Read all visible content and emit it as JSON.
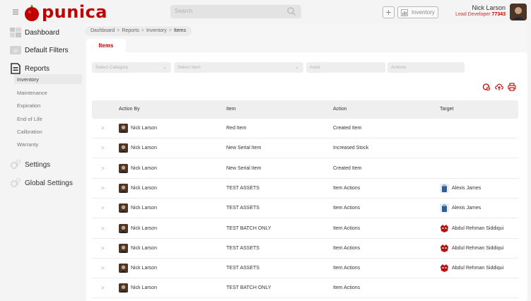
{
  "header": {
    "logo_text": "punica",
    "search_placeholder": "Search",
    "add_label": "+",
    "inventory_label": "Inventory",
    "user_name": "Nick Larson",
    "user_role": "Lead Developer",
    "user_id": "77343"
  },
  "sidebar": {
    "dashboard": "Dashboard",
    "default_filters": "Default Filters",
    "reports": "Reports",
    "report_items": [
      "Inventory",
      "Maintenance",
      "Expiration",
      "End of Life",
      "Calibration",
      "Warranty"
    ],
    "settings": "Settings",
    "global_settings": "Global Settings"
  },
  "breadcrumb": [
    "Dashboard",
    "Reports",
    "Inventory",
    "Items"
  ],
  "tab": "Items",
  "filters": {
    "category_placeholder": "Select Category",
    "item_placeholder": "Select Item",
    "actor_placeholder": "Actor",
    "actions_placeholder": "Actions"
  },
  "table": {
    "headers": [
      "Action By",
      "Item",
      "Action",
      "Target"
    ],
    "rows": [
      {
        "actor": "Nick Larson",
        "item": "Red Item",
        "action": "Created Item",
        "target": ""
      },
      {
        "actor": "Nick Larson",
        "item": "New Serial Item",
        "action": "Increased Stock",
        "target": ""
      },
      {
        "actor": "Nick Larson",
        "item": "New Serial Item",
        "action": "Created Item",
        "target": ""
      },
      {
        "actor": "Nick Larson",
        "item": "TEST ASSETS",
        "action": "Item Actions",
        "target": "Alexis James"
      },
      {
        "actor": "Nick Larson",
        "item": "TEST ASSETS",
        "action": "Item Actions",
        "target": "Alexis James"
      },
      {
        "actor": "Nick Larson",
        "item": "TEST BATCH ONLY",
        "action": "Item Actions",
        "target": "Abdul Rehman Siddiqui"
      },
      {
        "actor": "Nick Larson",
        "item": "TEST ASSETS",
        "action": "Item Actions",
        "target": "Abdul Rehman Siddiqui"
      },
      {
        "actor": "Nick Larson",
        "item": "TEST ASSETS",
        "action": "Item Actions",
        "target": "Abdul Rehman Siddiqui"
      },
      {
        "actor": "Nick Larson",
        "item": "TEST BATCH ONLY",
        "action": "Item Actions",
        "target": ""
      }
    ]
  },
  "colors": {
    "brand": "#c00000",
    "accent_text": "#c23838"
  },
  "icons": {
    "menu": "hamburger-icon",
    "search": "search-icon",
    "add": "plus-icon",
    "inventory": "chart-icon",
    "dashboard": "dashboard-grid-icon",
    "default_filters": "filter-id-icon",
    "reports": "document-icon",
    "settings": "gear-icon",
    "global_settings": "gear-icon",
    "toolbar": [
      "refresh-icon",
      "upload-cloud-icon",
      "printer-icon"
    ]
  }
}
